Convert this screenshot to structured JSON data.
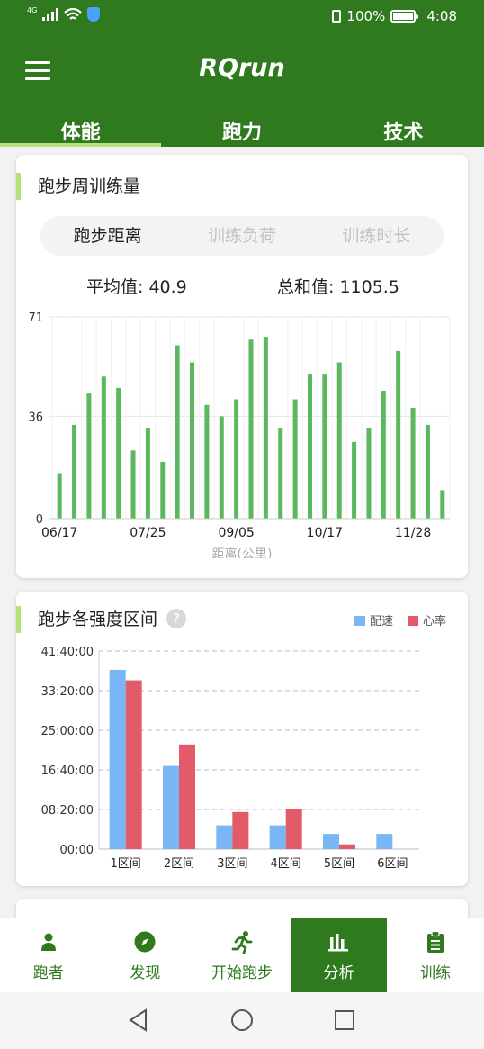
{
  "status_bar": {
    "signal": "4G",
    "battery": "100%",
    "time": "4:08"
  },
  "header": {
    "title": "RQrun"
  },
  "tabs": [
    {
      "label": "体能",
      "active": true
    },
    {
      "label": "跑力",
      "active": false
    },
    {
      "label": "技术",
      "active": false
    }
  ],
  "weekly": {
    "title": "跑步周训练量",
    "segments": [
      {
        "label": "跑步距离",
        "selected": true
      },
      {
        "label": "训练负荷",
        "selected": false
      },
      {
        "label": "训练时长",
        "selected": false
      }
    ],
    "avg_label": "平均值:",
    "avg_value": "40.9",
    "sum_label": "总和值:",
    "sum_value": "1105.5"
  },
  "zones": {
    "title": "跑步各强度区间",
    "help": "?",
    "legend": [
      {
        "name": "配速",
        "color": "#78b6f5"
      },
      {
        "name": "心率",
        "color": "#e35a68"
      }
    ]
  },
  "bottom_nav": [
    {
      "label": "跑者",
      "icon": "person-icon",
      "active": false
    },
    {
      "label": "发现",
      "icon": "compass-icon",
      "active": false
    },
    {
      "label": "开始跑步",
      "icon": "runner-icon",
      "active": false
    },
    {
      "label": "分析",
      "icon": "bar-chart-icon",
      "active": true
    },
    {
      "label": "训练",
      "icon": "clipboard-icon",
      "active": false
    }
  ],
  "chart_data": [
    {
      "type": "bar",
      "x_tick_labels": [
        "06/17",
        "07/25",
        "09/05",
        "10/17",
        "11/28"
      ],
      "values": [
        16,
        33,
        44,
        50,
        46,
        24,
        32,
        20,
        61,
        55,
        40,
        36,
        42,
        63,
        64,
        32,
        42,
        51,
        51,
        55,
        27,
        32,
        45,
        59,
        39,
        33,
        10
      ],
      "y_ticks": [
        "0",
        "36",
        "71"
      ],
      "ylim": [
        0,
        71
      ],
      "xlabel": "距离(公里)",
      "color": "#5cb85c",
      "grid": true
    },
    {
      "type": "bar",
      "categories": [
        "1区间",
        "2区间",
        "3区间",
        "4区间",
        "5区间",
        "6区间"
      ],
      "series": [
        {
          "name": "配速",
          "color": "#78b6f5",
          "values": [
            37.7,
            17.5,
            5.0,
            5.0,
            3.2,
            3.2
          ]
        },
        {
          "name": "心率",
          "color": "#e35a68",
          "values": [
            35.5,
            22.0,
            7.8,
            8.5,
            1.0,
            0
          ]
        }
      ],
      "y_ticks": [
        "00:00",
        "08:20:00",
        "16:40:00",
        "25:00:00",
        "33:20:00",
        "41:40:00"
      ],
      "ylim": [
        0,
        41.67
      ],
      "grid": "dashed"
    }
  ]
}
